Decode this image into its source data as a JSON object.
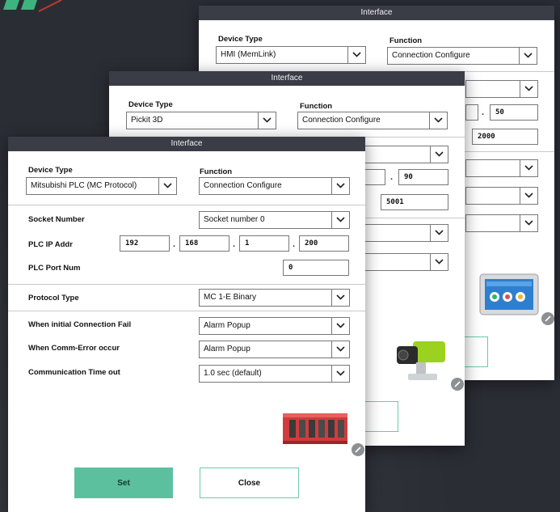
{
  "windows": {
    "hmi": {
      "title": "Interface",
      "device_type_label": "Device Type",
      "device_type_value": "HMI (MemLink)",
      "function_label": "Function",
      "function_value": "Connection Configure",
      "ip_last_octet": "50",
      "port": "2000",
      "device_icon": "hmi-panel-icon"
    },
    "pickit": {
      "title": "Interface",
      "device_type_label": "Device Type",
      "device_type_value": "Pickit 3D",
      "function_label": "Function",
      "function_value": "Connection Configure",
      "ip_last_octet": "90",
      "port": "5001",
      "device_icon": "pickit-camera-icon"
    },
    "plc": {
      "title": "Interface",
      "device_type_label": "Device Type",
      "device_type_value": "Mitsubishi PLC (MC Protocol)",
      "function_label": "Function",
      "function_value": "Connection Configure",
      "socket_number_label": "Socket Number",
      "socket_number_value": "Socket number 0",
      "plc_ip_label": "PLC IP Addr",
      "ip": [
        "192",
        "168",
        "1",
        "200"
      ],
      "plc_port_label": "PLC Port Num",
      "plc_port_value": "0",
      "protocol_type_label": "Protocol Type",
      "protocol_type_value": "MC 1-E Binary",
      "initial_fail_label": "When initial Connection Fail",
      "initial_fail_value": "Alarm Popup",
      "comm_error_label": "When Comm-Error occur",
      "comm_error_value": "Alarm Popup",
      "timeout_label": "Communication Time out",
      "timeout_value": "1.0 sec (default)",
      "set_label": "Set",
      "close_label": "Close",
      "device_icon": "plc-module-icon"
    }
  },
  "colors": {
    "background": "#2b2d35",
    "titlebar": "#3a3c46",
    "accent": "#5cc09f",
    "logo": "#3fb37f"
  }
}
